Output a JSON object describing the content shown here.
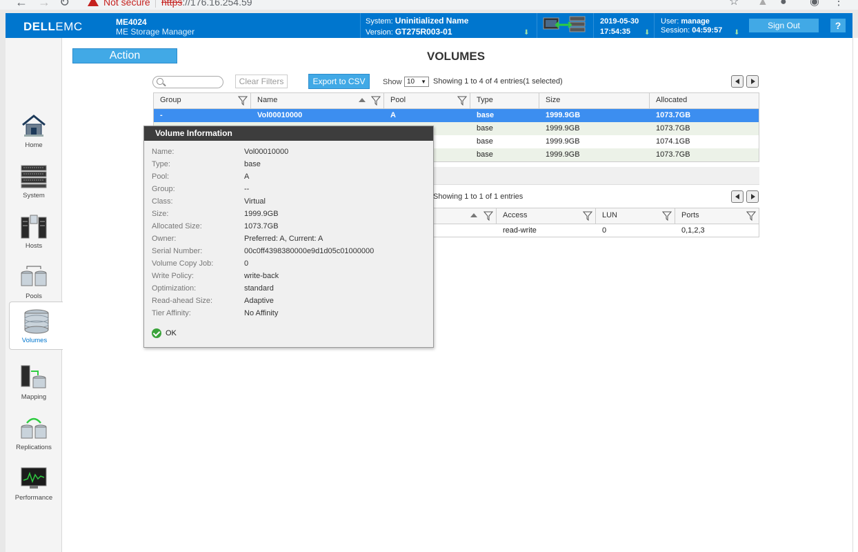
{
  "browser": {
    "not_secure": "Not secure",
    "url_proto": "https",
    "url_rest": "://176.16.254.59"
  },
  "header": {
    "logo_dell": "DELL",
    "logo_emc": "EMC",
    "product": "ME4024",
    "product_sub": "ME Storage Manager",
    "system_label": "System:",
    "system_value": "Uninitialized Name",
    "version_label": "Version:",
    "version_value": "GT275R003-01",
    "date": "2019-05-30",
    "time": "17:54:35",
    "user_label": "User:",
    "user_value": "manage",
    "session_label": "Session:",
    "session_value": "04:59:57",
    "signout": "Sign Out",
    "help": "?"
  },
  "sidebar": {
    "items": [
      {
        "label": "Home",
        "icon": "home-icon"
      },
      {
        "label": "System",
        "icon": "system-icon"
      },
      {
        "label": "Hosts",
        "icon": "hosts-icon"
      },
      {
        "label": "Pools",
        "icon": "pools-icon"
      },
      {
        "label": "Volumes",
        "icon": "volumes-icon"
      },
      {
        "label": "Mapping",
        "icon": "mapping-icon"
      },
      {
        "label": "Replications",
        "icon": "replications-icon"
      },
      {
        "label": "Performance",
        "icon": "performance-icon"
      }
    ],
    "active": "Volumes"
  },
  "action": "Action",
  "page_title": "VOLUMES",
  "toolbar": {
    "clear_filters": "Clear Filters",
    "export": "Export to CSV",
    "show": "Show",
    "show_value": "10",
    "entries": "Showing 1 to 4 of 4 entries(1 selected)"
  },
  "volumes_table": {
    "headers": [
      "Group",
      "Name",
      "Pool",
      "Type",
      "Size",
      "Allocated"
    ],
    "rows": [
      {
        "group": "-",
        "name": "Vol00010000",
        "pool": "A",
        "type": "base",
        "size": "1999.9GB",
        "allocated": "1073.7GB"
      },
      {
        "group": "",
        "name": "",
        "pool": "",
        "type": "base",
        "size": "1999.9GB",
        "allocated": "1073.7GB"
      },
      {
        "group": "",
        "name": "",
        "pool": "",
        "type": "base",
        "size": "1999.9GB",
        "allocated": "1074.1GB"
      },
      {
        "group": "",
        "name": "",
        "pool": "",
        "type": "base",
        "size": "1999.9GB",
        "allocated": "1073.7GB"
      }
    ]
  },
  "mapping": {
    "entries": "Showing 1 to 1 of 1 entries",
    "headers": [
      "Access",
      "LUN",
      "Ports"
    ],
    "rows": [
      {
        "access": "read-write",
        "lun": "0",
        "ports": "0,1,2,3"
      }
    ]
  },
  "popup": {
    "title": "Volume Information",
    "fields": [
      {
        "k": "Name:",
        "v": "Vol00010000"
      },
      {
        "k": "Type:",
        "v": "base"
      },
      {
        "k": "Pool:",
        "v": "A"
      },
      {
        "k": "Group:",
        "v": "--"
      },
      {
        "k": "Class:",
        "v": "Virtual"
      },
      {
        "k": "Size:",
        "v": "1999.9GB"
      },
      {
        "k": "Allocated Size:",
        "v": "1073.7GB"
      },
      {
        "k": "Owner:",
        "v": "Preferred: A, Current: A"
      },
      {
        "k": "Serial Number:",
        "v": "00c0ff4398380000e9d1d05c01000000"
      },
      {
        "k": "Volume Copy Job:",
        "v": "0"
      },
      {
        "k": "Write Policy:",
        "v": "write-back"
      },
      {
        "k": "Optimization:",
        "v": "standard"
      },
      {
        "k": "Read-ahead Size:",
        "v": "Adaptive"
      },
      {
        "k": "Tier Affinity:",
        "v": "No Affinity"
      }
    ],
    "ok": "OK"
  },
  "colors": {
    "brand_blue": "#0076ce",
    "button_blue": "#41a9e6",
    "selected_row": "#3c8ef0",
    "alt_row": "#ecf2e8",
    "ok_green": "#3aa33a"
  }
}
